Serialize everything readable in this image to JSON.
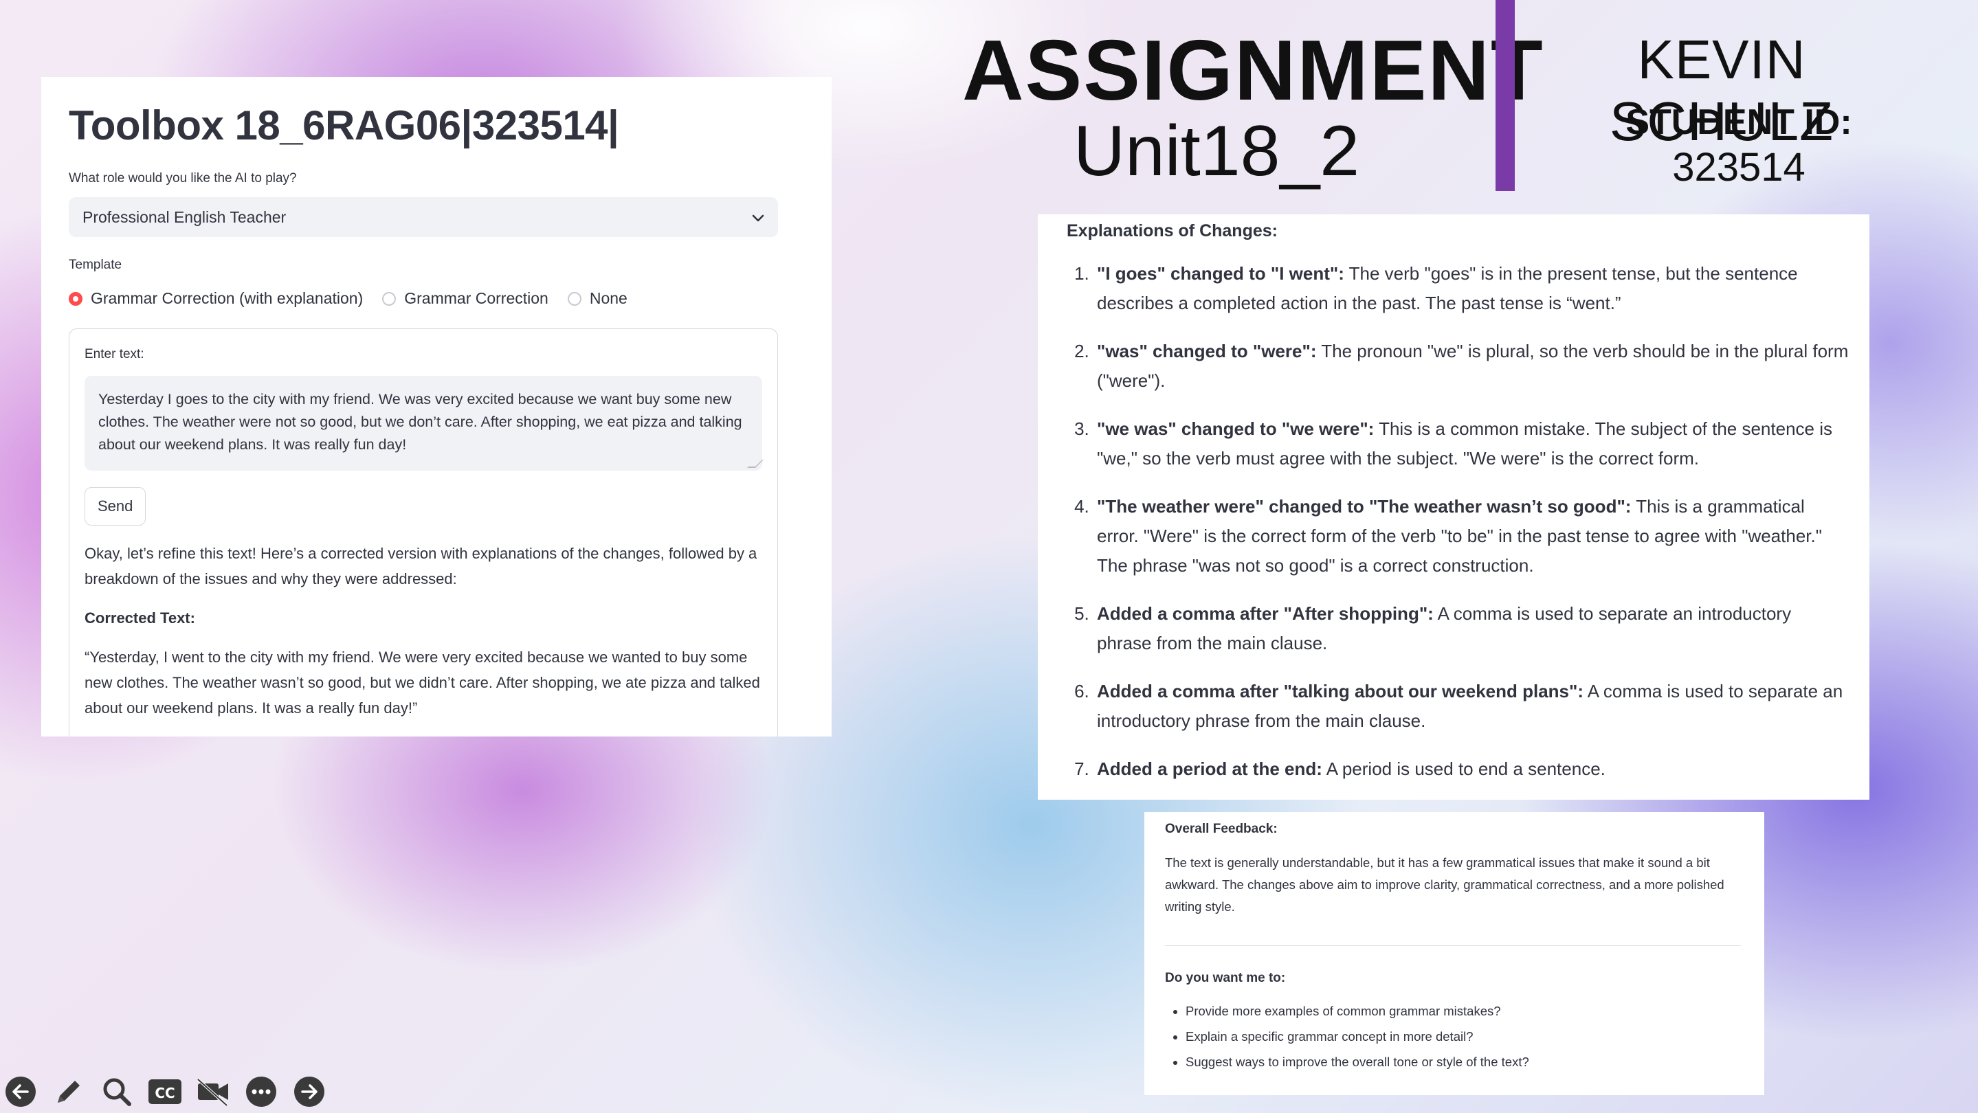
{
  "app": {
    "title": "Toolbox 18_6RAG06|323514|",
    "role_label": "What role would you like the AI to play?",
    "role_selected": "Professional English Teacher",
    "template_label": "Template",
    "template_options": [
      {
        "label": "Grammar Correction (with explanation)",
        "selected": true
      },
      {
        "label": "Grammar Correction",
        "selected": false
      },
      {
        "label": "None",
        "selected": false
      }
    ],
    "enter_text_label": "Enter text:",
    "input_text": "Yesterday I goes to the city with my friend. We was very excited because we want buy some new clothes. The weather were not so good, but we don’t care. After shopping, we eat pizza and talking about our weekend plans. It was really fun day!",
    "send_label": "Send",
    "response_intro": "Okay, let’s refine this text! Here’s a corrected version with explanations of the changes, followed by a breakdown of the issues and why they were addressed:",
    "corrected_heading": "Corrected Text:",
    "corrected_text": "“Yesterday, I went to the city with my friend. We were very excited because we wanted to buy some new clothes. The weather wasn’t so good, but we didn’t care. After shopping, we ate pizza and talked about our weekend plans. It was a really fun day!”"
  },
  "header": {
    "assignment": "ASSIGNMENT",
    "unit": "Unit18_2",
    "name": "KEVIN SCHULZ",
    "student_id_label": "STUDENT ID:",
    "student_id": "323514",
    "accent_color": "#7a3aa8"
  },
  "explanations": {
    "heading": "Explanations of Changes:",
    "items": [
      {
        "bold": "\"I goes\" changed to \"I went\":",
        "text": " The verb \"goes\" is in the present tense, but the sentence describes a completed action in the past. The past tense is “went.”"
      },
      {
        "bold": "\"was\" changed to \"were\":",
        "text": " The pronoun \"we\" is plural, so the verb should be in the plural form (\"were\")."
      },
      {
        "bold": "\"we was\" changed to \"we were\":",
        "text": " This is a common mistake. The subject of the sentence is \"we,\" so the verb must agree with the subject. \"We were\" is the correct form."
      },
      {
        "bold": "\"The weather were\" changed to \"The weather wasn’t so good\":",
        "text": " This is a grammatical error. \"Were\" is the correct form of the verb \"to be\" in the past tense to agree with \"weather.\" The phrase \"was not so good\" is a correct construction."
      },
      {
        "bold": "Added a comma after \"After shopping\":",
        "text": " A comma is used to separate an introductory phrase from the main clause."
      },
      {
        "bold": "Added a comma after \"talking about our weekend plans\":",
        "text": " A comma is used to separate an introductory phrase from the main clause."
      },
      {
        "bold": "Added a period at the end:",
        "text": " A period is used to end a sentence."
      }
    ]
  },
  "feedback": {
    "heading": "Overall Feedback:",
    "body": "The text is generally understandable, but it has a few grammatical issues that make it sound a bit awkward. The changes above aim to improve clarity, grammatical correctness, and a more polished writing style.",
    "question": "Do you want me to:",
    "options": [
      "Provide more examples of common grammar mistakes?",
      "Explain a specific grammar concept in more detail?",
      "Suggest ways to improve the overall tone or style of the text?"
    ]
  },
  "toolbar": {
    "icons": [
      "arrow-left-icon",
      "pen-icon",
      "zoom-icon",
      "captions-icon",
      "video-off-icon",
      "more-icon",
      "arrow-right-icon"
    ]
  }
}
